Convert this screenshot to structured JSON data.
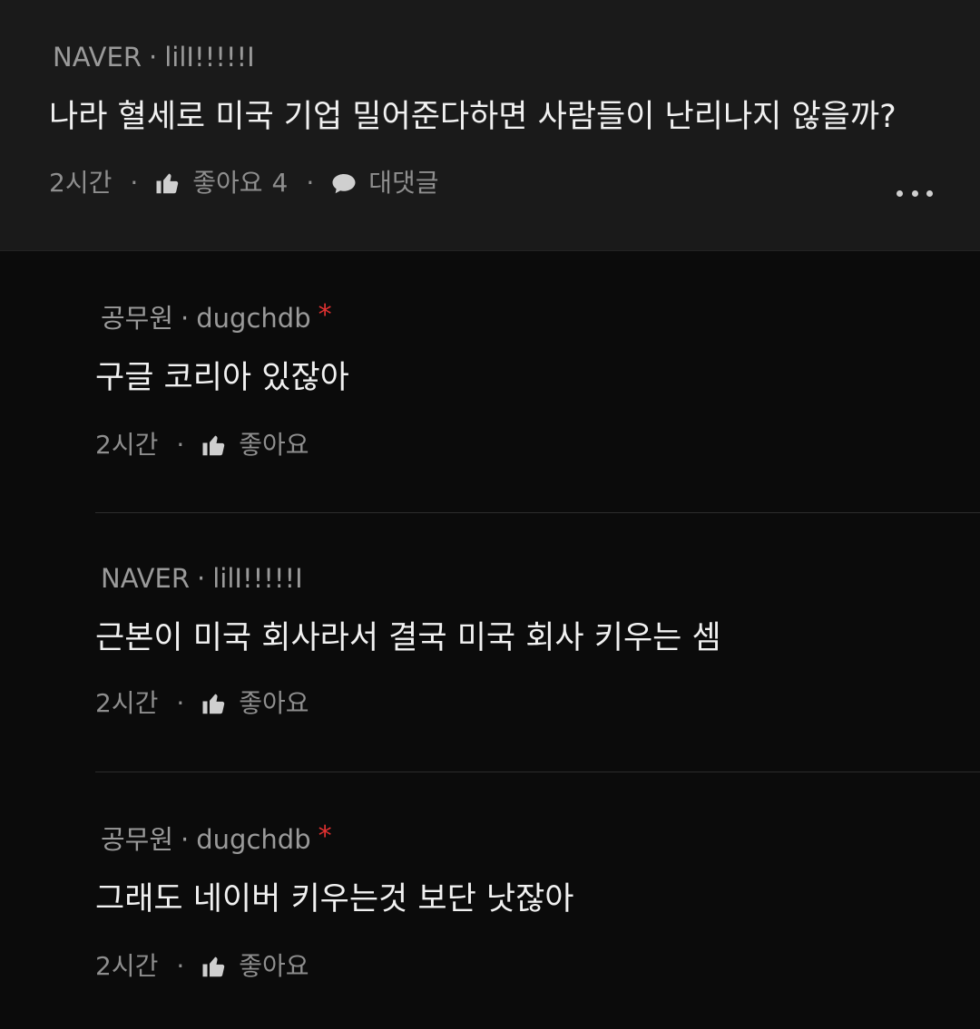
{
  "colors": {
    "background": "#0b0b0b",
    "main_comment_bg": "#1a1a1a",
    "text_primary": "#f1f1f1",
    "text_secondary": "#9a9a9a",
    "star": "#e03131"
  },
  "main_comment": {
    "company": "NAVER",
    "username": "lilI!!!!!I",
    "text": "나라 혈세로 미국 기업 밀어준다하면 사람들이 난리나지 않을까?",
    "time": "2시간",
    "like_label": "좋아요",
    "like_count": "4",
    "reply_label": "대댓글"
  },
  "replies": [
    {
      "company": "공무원",
      "username": "dugchdb",
      "star": "*",
      "text": "구글 코리아 있잖아",
      "time": "2시간",
      "like_label": "좋아요"
    },
    {
      "company": "NAVER",
      "username": "lilI!!!!!I",
      "text": "근본이 미국 회사라서 결국 미국 회사 키우는 셈",
      "time": "2시간",
      "like_label": "좋아요"
    },
    {
      "company": "공무원",
      "username": "dugchdb",
      "star": "*",
      "text": "그래도 네이버 키우는것 보단 낫잖아",
      "time": "2시간",
      "like_label": "좋아요"
    }
  ],
  "icons": {
    "like": "thumbs-up-icon",
    "reply": "speech-bubble-icon",
    "more": "more-horizontal-icon"
  }
}
